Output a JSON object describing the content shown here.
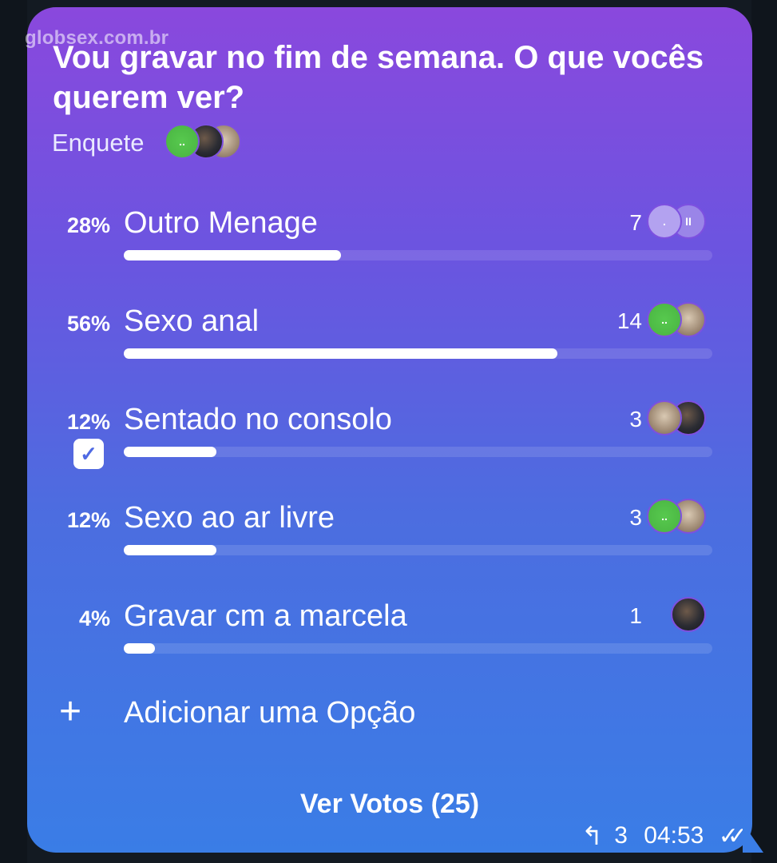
{
  "watermark": "globsex.com.br",
  "poll": {
    "question": "Vou gravar no fim de semana. O que vocês querem ver?",
    "type_label": "Enquete",
    "options": [
      {
        "percent": "28%",
        "label": "Outro Menage",
        "votes": "7",
        "fraction": 0.28,
        "chosen": false
      },
      {
        "percent": "56%",
        "label": "Sexo anal",
        "votes": "14",
        "fraction": 0.56,
        "chosen": false
      },
      {
        "percent": "12%",
        "label": "Sentado no consolo",
        "votes": "3",
        "fraction": 0.12,
        "chosen": true
      },
      {
        "percent": "12%",
        "label": "Sexo ao ar livre",
        "votes": "3",
        "fraction": 0.12,
        "chosen": false
      },
      {
        "percent": "4%",
        "label": "Gravar cm a marcela",
        "votes": "1",
        "fraction": 0.04,
        "chosen": false
      }
    ],
    "add_option_label": "Adicionar uma Opção",
    "view_votes_label": "Ver Votos (25)"
  },
  "message_meta": {
    "replies": "3",
    "time": "04:53",
    "icons": [
      "reply-icon",
      "double-check-icon"
    ]
  },
  "colors": {
    "gradient_top": "#8a48dd",
    "gradient_bottom": "#3a7de6",
    "check_accent": "#4f6ae3"
  }
}
